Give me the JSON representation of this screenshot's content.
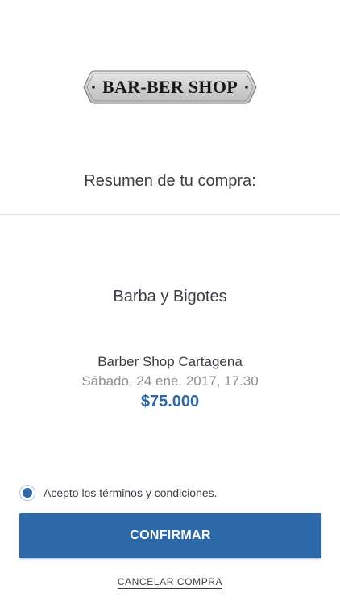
{
  "brand": {
    "logo_text": "BAR-BER SHOP"
  },
  "summary": {
    "title": "Resumen de tu compra:"
  },
  "purchase": {
    "service": "Barba y Bigotes",
    "shop": "Barber Shop Cartagena",
    "datetime": "Sábado, 24 ene. 2017, 17.30",
    "price": "$75.000"
  },
  "terms": {
    "label": "Acepto los términos y condiciones.",
    "checked": true
  },
  "actions": {
    "confirm_label": "CONFIRMAR",
    "cancel_label": "CANCELAR COMPRA"
  },
  "colors": {
    "accent": "#2d68a8",
    "text": "#3a3f47",
    "muted": "#8b8e93"
  }
}
